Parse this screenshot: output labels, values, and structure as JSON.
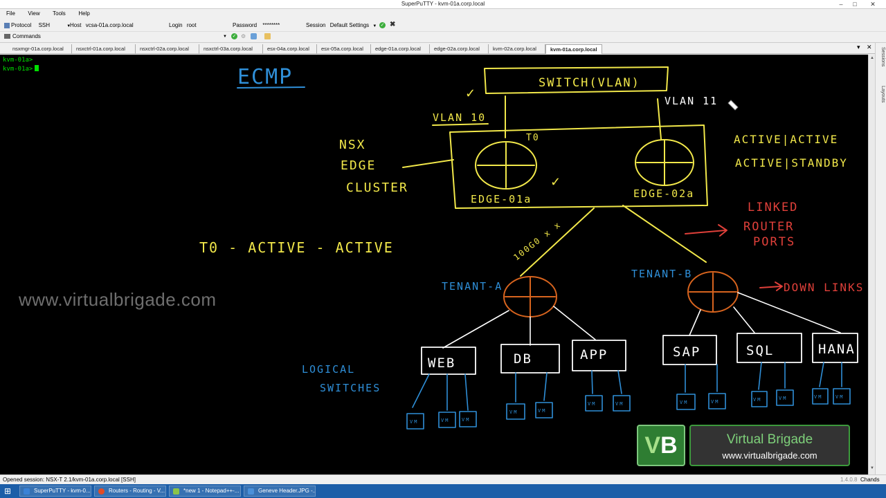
{
  "window": {
    "title": "SuperPuTTY - kvm-01a.corp.local"
  },
  "menu": [
    "File",
    "View",
    "Tools",
    "Help"
  ],
  "toolbar": {
    "protocol_label": "Protocol",
    "protocol_value": "SSH",
    "host_label": "Host",
    "host_value": "vcsa-01a.corp.local",
    "login_label": "Login",
    "login_value": "root",
    "password_label": "Password",
    "password_value": "********",
    "session_label": "Session",
    "session_value": "Default Settings"
  },
  "commands": {
    "label": "Commands"
  },
  "tabs": [
    "nsxmgr-01a.corp.local",
    "nsxctrl-01a.corp.local",
    "nsxctrl-02a.corp.local",
    "nsxctrl-03a.corp.local",
    "esx-04a.corp.local",
    "esx-05a.corp.local",
    "edge-01a.corp.local",
    "edge-02a.corp.local",
    "kvm-02a.corp.local",
    "kvm-01a.corp.local"
  ],
  "active_tab_index": 9,
  "terminal": {
    "lines": [
      "kvm-01a>",
      "kvm-01a>"
    ]
  },
  "side_tabs": [
    "Sessions",
    "Layouts"
  ],
  "status": {
    "message": "Opened session: NSX-T 2.1/kvm-01a.corp.local [SSH]",
    "version": "1.4.0.8",
    "right": "Chands"
  },
  "taskbar": [
    {
      "label": "SuperPuTTY - kvm-0...",
      "color": "#3b82d6"
    },
    {
      "label": "Routers - Routing - V...",
      "color": "#e34c26"
    },
    {
      "label": "*new 1 - Notepad++-...",
      "color": "#8bc34a"
    },
    {
      "label": "Geneve Header.JPG -...",
      "color": "#4a90d9"
    }
  ],
  "watermark": "www.virtualbrigade.com",
  "logo": {
    "initials_v": "V",
    "initials_b": "B",
    "line1": "Virtual Brigade",
    "line2": "www.virtualbrigade.com"
  },
  "sketch": {
    "title": "ECMP",
    "switch": "SWITCH(VLAN)",
    "vlan10": "VLAN 10",
    "vlan11": "VLAN 11",
    "t0": "T0",
    "edge_cluster": [
      "NSX",
      "EDGE",
      "CLUSTER"
    ],
    "edge1": "EDGE-01a",
    "edge2": "EDGE-02a",
    "modes": [
      "ACTIVE|ACTIVE",
      "ACTIVE|STANDBY"
    ],
    "t0_active": "T0 - ACTIVE - ACTIVE",
    "speed": "100G0 x x",
    "linked": [
      "LINKED",
      "ROUTER",
      "PORTS"
    ],
    "downlinks": "DOWN LINKS",
    "tenant_a": "TENANT-A",
    "tenant_b": "TENANT-B",
    "logical_switches": [
      "LOGICAL",
      "SWITCHES"
    ],
    "switches": [
      "WEB",
      "DB",
      "APP",
      "SAP",
      "SQL",
      "HANA"
    ],
    "vm": "VM"
  },
  "colors": {
    "yellow": "#f2e84a",
    "orange": "#d8641e",
    "blue": "#2f8fd8",
    "white": "#ffffff",
    "red": "#e0403a"
  }
}
